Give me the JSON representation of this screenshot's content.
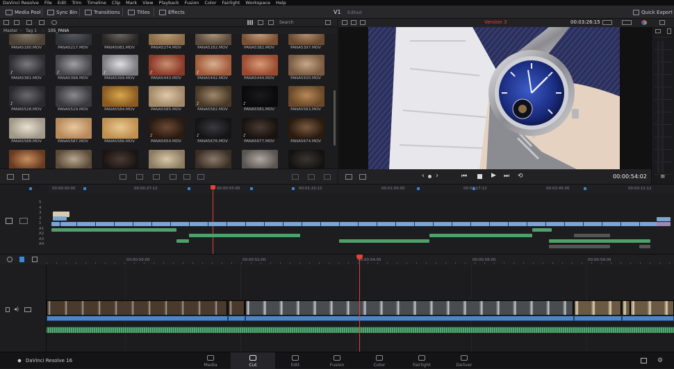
{
  "menu": [
    "DaVinci Resolve",
    "File",
    "Edit",
    "Trim",
    "Timeline",
    "Clip",
    "Mark",
    "View",
    "Playback",
    "Fusion",
    "Color",
    "Fairlight",
    "Workspace",
    "Help"
  ],
  "toolbar": {
    "media_pool": "Media Pool",
    "sync_bin": "Sync Bin",
    "transitions": "Transitions",
    "titles": "Titles",
    "effects": "Effects",
    "v1": "V1",
    "edited": "Edited",
    "quick_export": "Quick Export"
  },
  "pool": {
    "search_placeholder": "Search",
    "breadcrumb": [
      "Master",
      "Tag 1",
      "105_PANA"
    ]
  },
  "clips": [
    {
      "name": "PANA5180.MOV",
      "c1": "#8a8070",
      "c2": "#4a4034",
      "audio": false
    },
    {
      "name": "PANA5217.MOV",
      "c1": "#5a5e62",
      "c2": "#2e3034",
      "audio": false
    },
    {
      "name": "PANA5081.MOV",
      "c1": "#6e6a66",
      "c2": "#2a2826",
      "audio": false
    },
    {
      "name": "PANA5274.MOV",
      "c1": "#c0a078",
      "c2": "#8a6a48",
      "audio": false
    },
    {
      "name": "PANA5182.MOV",
      "c1": "#b0987c",
      "c2": "#5a4a3a",
      "audio": false
    },
    {
      "name": "PANA5382.MOV",
      "c1": "#c8a080",
      "c2": "#7a5034",
      "audio": false
    },
    {
      "name": "PANA5397.MOV",
      "c1": "#b89070",
      "c2": "#6a4a30",
      "audio": false
    },
    {
      "name": "PANA5381.MOV",
      "c1": "#7a7a7e",
      "c2": "#2e2e32",
      "audio": true
    },
    {
      "name": "PANA5398.MOV",
      "c1": "#a0a0a4",
      "c2": "#46464a",
      "audio": true
    },
    {
      "name": "PANA5399.MOV",
      "c1": "#e0e0e4",
      "c2": "#7a7a7e",
      "audio": true
    },
    {
      "name": "PANA5443.MOV",
      "c1": "#c89070",
      "c2": "#8a3828",
      "audio": true
    },
    {
      "name": "PANA5442.MOV",
      "c1": "#d8b090",
      "c2": "#a05a3a",
      "audio": true
    },
    {
      "name": "PANA5444.MOV",
      "c1": "#d89a78",
      "c2": "#9a4a30",
      "audio": false
    },
    {
      "name": "PANA5500.MOV",
      "c1": "#c8a888",
      "c2": "#7a5a40",
      "audio": false
    },
    {
      "name": "PANA5528.MOV",
      "c1": "#6a6a6e",
      "c2": "#2a2a2e",
      "audio": true
    },
    {
      "name": "PANA5529.MOV",
      "c1": "#8a8a8e",
      "c2": "#3a3a3e",
      "audio": false
    },
    {
      "name": "PANA5584.MOV",
      "c1": "#d8a850",
      "c2": "#8a5a20",
      "audio": false
    },
    {
      "name": "PANA5585.MOV",
      "c1": "#e0c8a8",
      "c2": "#a08868",
      "audio": false
    },
    {
      "name": "PANA5582.MOV",
      "c1": "#a08868",
      "c2": "#483828",
      "audio": true
    },
    {
      "name": "PANA5581.MOV",
      "c1": "#1a1a1c",
      "c2": "#0a0a0c",
      "audio": true
    },
    {
      "name": "PANA5583.MOV",
      "c1": "#b88858",
      "c2": "#684828",
      "audio": false
    },
    {
      "name": "PANA5588.MOV",
      "c1": "#e8e0d0",
      "c2": "#a09888",
      "audio": false
    },
    {
      "name": "PANA5587.MOV",
      "c1": "#e8c8a0",
      "c2": "#b88a5a",
      "audio": false
    },
    {
      "name": "PANA5586.MOV",
      "c1": "#e8c890",
      "c2": "#c09050",
      "audio": false
    },
    {
      "name": "PANA5654.MOV",
      "c1": "#6a4a34",
      "c2": "#2a1a10",
      "audio": true
    },
    {
      "name": "PANA5676.MOV",
      "c1": "#3a3a3e",
      "c2": "#141416",
      "audio": true
    },
    {
      "name": "PANA5677.MOV",
      "c1": "#4a3a30",
      "c2": "#181210",
      "audio": true
    },
    {
      "name": "PANA5674.MOV",
      "c1": "#7a5a40",
      "c2": "#2a1a10",
      "audio": false
    },
    {
      "name": "",
      "c1": "#c89060",
      "c2": "#6a3a20",
      "audio": false
    },
    {
      "name": "",
      "c1": "#b8a890",
      "c2": "#5a4a38",
      "audio": false
    },
    {
      "name": "",
      "c1": "#4a3a34",
      "c2": "#1a1412",
      "audio": false
    },
    {
      "name": "",
      "c1": "#d8c8a8",
      "c2": "#8a7a60",
      "audio": false
    },
    {
      "name": "",
      "c1": "#8a7a6a",
      "c2": "#3a2e24",
      "audio": false
    },
    {
      "name": "",
      "c1": "#b0a8a0",
      "c2": "#5a5450",
      "audio": false
    },
    {
      "name": "",
      "c1": "#3a3430",
      "c2": "#141210",
      "audio": false
    }
  ],
  "viewer": {
    "version": "Version 3",
    "timecode": "00:03:26:15",
    "play_timecode": "00:00:54:02"
  },
  "overview": {
    "ruler": [
      "00:00:00:00",
      "00:00:27:12",
      "00:00:55:00",
      "00:01:22:12",
      "00:01:50:00",
      "00:02:17:12",
      "00:02:45:00",
      "00:03:12:12"
    ],
    "track_labels": [
      "5",
      "4",
      "3",
      "2",
      "1",
      "A1",
      "A2",
      "A3",
      "A4"
    ]
  },
  "detail": {
    "ruler": [
      "00:00:50:00",
      "00:00:52:00",
      "00:00:54:00",
      "00:00:56:00",
      "00:00:58:00"
    ]
  },
  "footer": {
    "app_name": "DaVinci Resolve 16"
  },
  "nav": [
    {
      "label": "Media",
      "active": false
    },
    {
      "label": "Cut",
      "active": true
    },
    {
      "label": "Edit",
      "active": false
    },
    {
      "label": "Fusion",
      "active": false
    },
    {
      "label": "Color",
      "active": false
    },
    {
      "label": "Fairlight",
      "active": false
    },
    {
      "label": "Deliver",
      "active": false
    }
  ],
  "colors": {
    "accent_red": "#e0433a",
    "clip_blue": "#7aa6d6",
    "audio_green": "#4fa06a"
  }
}
